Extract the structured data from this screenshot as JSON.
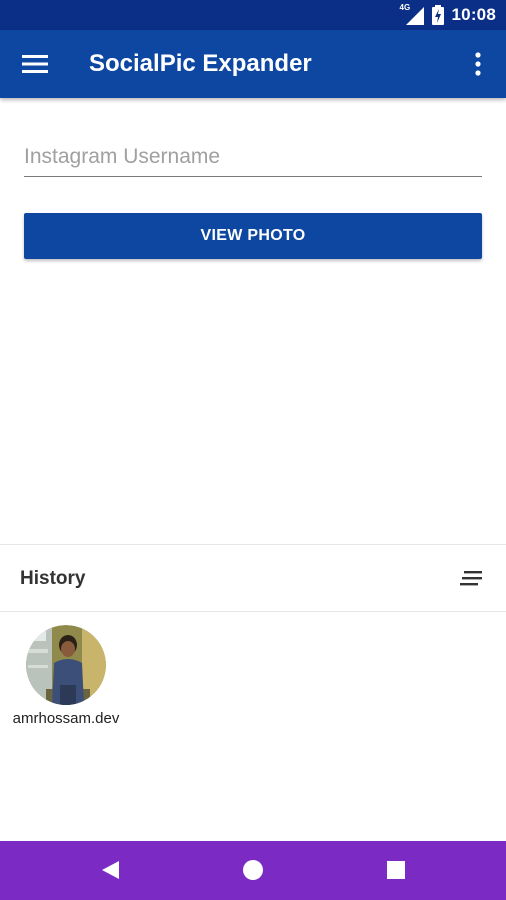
{
  "status_bar": {
    "time": "10:08",
    "network": "4G",
    "icons": [
      "signal-icon",
      "battery-charging-icon"
    ]
  },
  "app_bar": {
    "title": "SocialPic Expander",
    "icons": [
      "menu-icon",
      "more-vert-icon"
    ]
  },
  "form": {
    "username_placeholder": "Instagram Username",
    "username_value": "",
    "view_button_label": "VIEW PHOTO"
  },
  "history": {
    "title": "History",
    "sort_icon": "sort-icon",
    "items": [
      {
        "username": "amrhossam.dev",
        "avatar": "profile-photo"
      }
    ]
  },
  "nav_bar": {
    "icons": [
      "back-icon",
      "home-icon",
      "recents-icon"
    ]
  },
  "colors": {
    "status_bar": "#0b2f86",
    "primary": "#0d47a1",
    "nav_bar": "#7b2bc4"
  }
}
